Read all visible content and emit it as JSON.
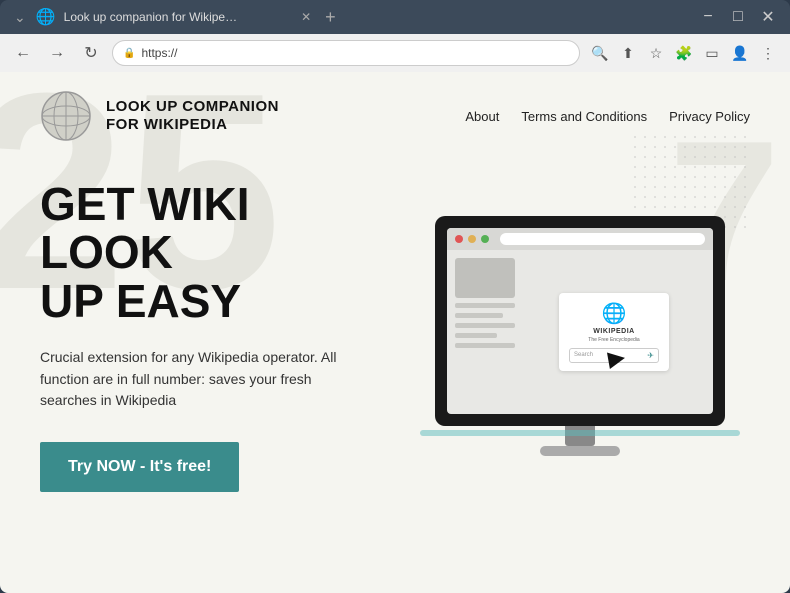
{
  "browser": {
    "title": "Look up companion for Wikipe…",
    "tab_label": "Look up companion for Wikipe…",
    "address": "https://",
    "new_tab_label": "+"
  },
  "header": {
    "logo_text_line1": "LOOK UP COMPANION",
    "logo_text_line2": "FOR WIKIPEDIA",
    "nav": {
      "about": "About",
      "terms": "Terms and Conditions",
      "privacy": "Privacy Policy"
    }
  },
  "hero": {
    "title_line1": "GET WIKI LOOK",
    "title_line2": "UP EASY",
    "description": "Crucial extension for any Wikipedia operator. All function are in full number: saves your fresh searches in Wikipedia",
    "cta_label": "Try NOW - It's free!"
  },
  "monitor": {
    "wikipedia_title": "WIKIPEDIA",
    "wikipedia_subtitle": "The Free Encyclopedia",
    "search_placeholder": "Search",
    "dots": [
      "red",
      "yellow",
      "green"
    ]
  },
  "bg": {
    "number1": "25",
    "number2": "7"
  },
  "colors": {
    "teal": "#3a8c8c",
    "dark": "#1a1a1a",
    "light_bg": "#f5f5f0"
  }
}
